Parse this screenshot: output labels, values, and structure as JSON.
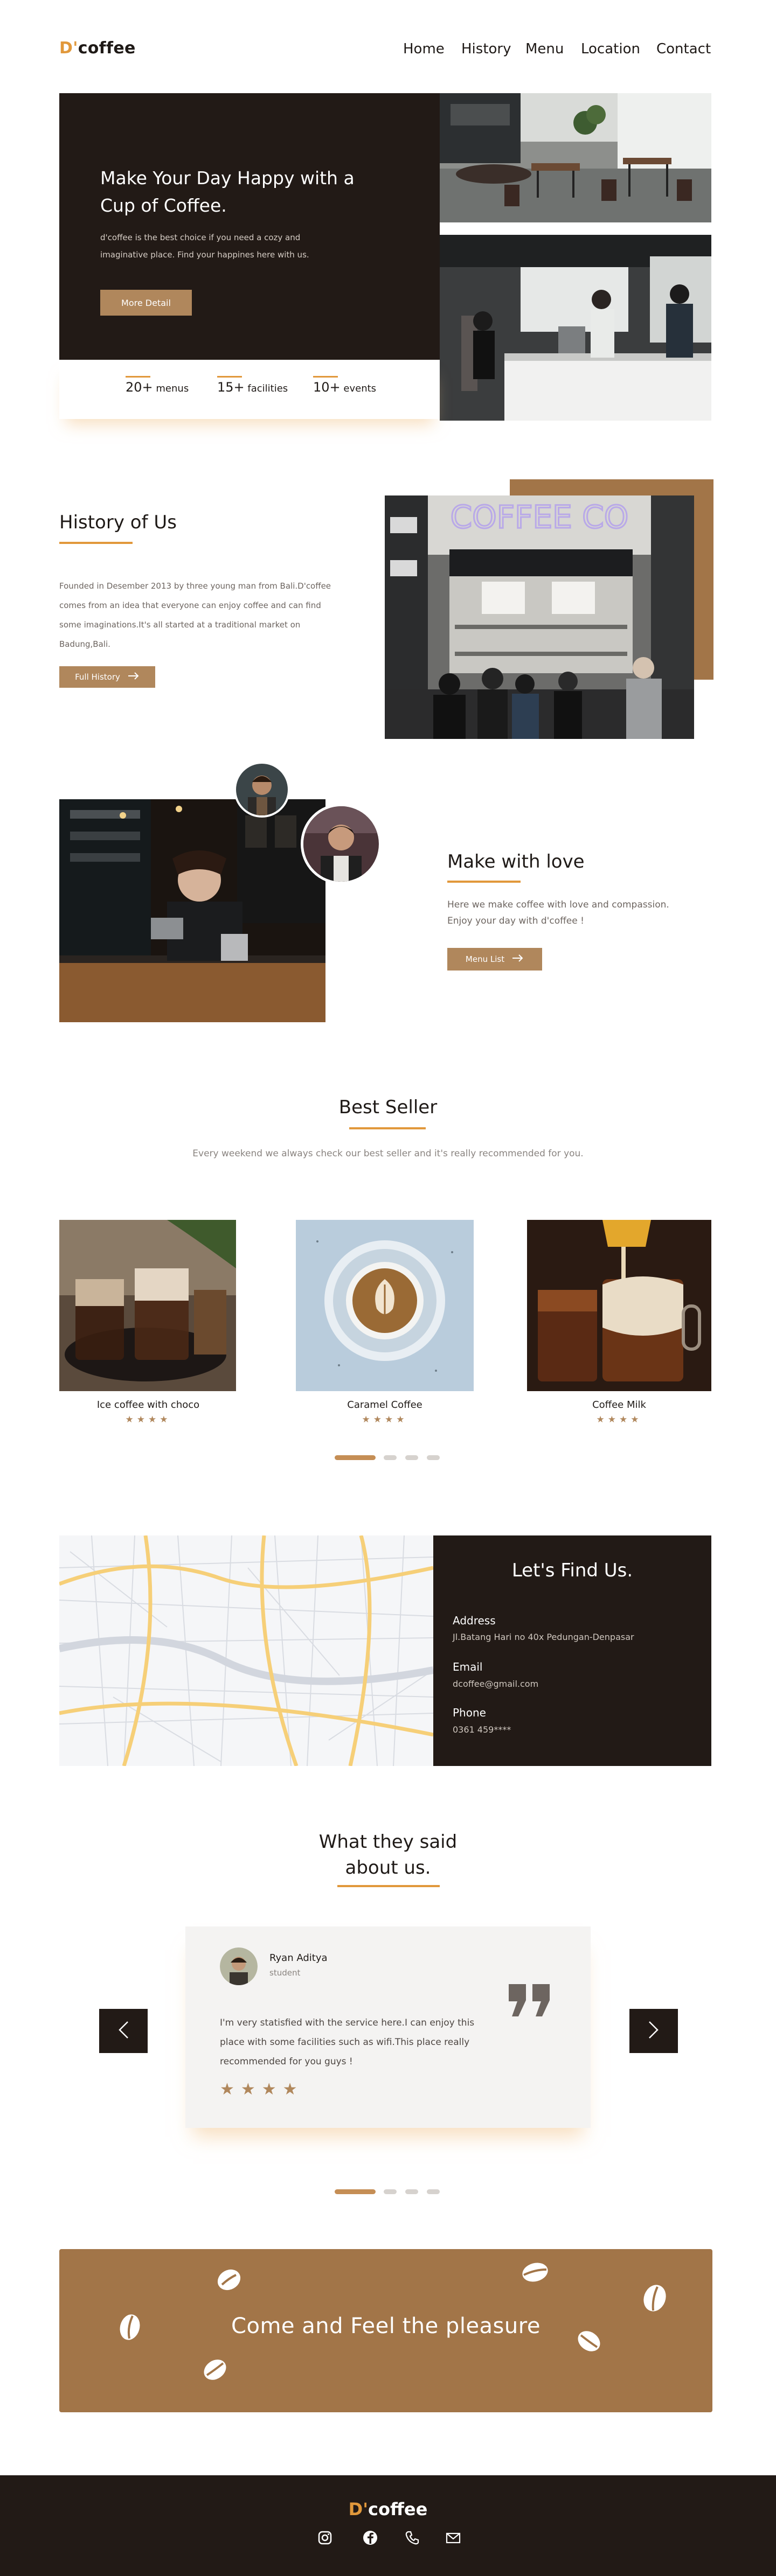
{
  "brand": {
    "prefix": "D'",
    "name": "coffee"
  },
  "nav": {
    "items": [
      "Home",
      "History",
      "Menu",
      "Location",
      "Contact"
    ]
  },
  "hero": {
    "title": "Make Your Day Happy with a Cup of Coffee.",
    "description": "d'coffee is the best choice if you need a cozy and imaginative place. Find your happines here with us.",
    "button": "More Detail",
    "stats": [
      {
        "value": "20+",
        "label": "menus"
      },
      {
        "value": "15+",
        "label": "facilities"
      },
      {
        "value": "10+",
        "label": "events"
      }
    ]
  },
  "history": {
    "title": "History of Us",
    "text": "Founded in Desember 2013 by three young man from Bali.D'coffee comes from an idea that everyone can enjoy coffee and can find some imaginations.It's all started at a traditional market on Badung,Bali.",
    "button": "Full History",
    "sign_text": "COFFEE CO"
  },
  "love": {
    "title": "Make with love",
    "text": "Here we make coffee with love and compassion. Enjoy your day with d'coffee !",
    "button": "Menu List"
  },
  "best_seller": {
    "title": "Best Seller",
    "subtitle": "Every weekend we always check our best seller and it's really recommended for you.",
    "items": [
      {
        "name": "Ice coffee with choco",
        "rating": 4
      },
      {
        "name": "Caramel Coffee",
        "rating": 4
      },
      {
        "name": "Coffee Milk",
        "rating": 4
      }
    ],
    "stars_text": "★★★★"
  },
  "find_us": {
    "title": "Let's Find Us.",
    "address_label": "Address",
    "address": "Jl.Batang Hari no 40x Pedungan-Denpasar",
    "email_label": "Email",
    "email": "dcoffee@gmail.com",
    "phone_label": "Phone",
    "phone": "0361 459****"
  },
  "testimonials": {
    "title_line1": "What they said",
    "title_line2": "about us.",
    "name": "Ryan Aditya",
    "role": "student",
    "text": "I'm very statisfied with the service here.I can enjoy this place with some facilities such as wifi.This place really recommended for you guys !",
    "stars_text": "★★★★",
    "rating": 4
  },
  "banner": {
    "text": "Come and Feel the pleasure"
  },
  "footer": {
    "prefix": "D'",
    "name": "coffee",
    "socials": [
      "instagram-icon",
      "facebook-icon",
      "phone-icon",
      "mail-icon"
    ]
  },
  "colors": {
    "dark": "#221a16",
    "accent": "#e1983b",
    "brown": "#a27548",
    "button": "#b0875c"
  }
}
